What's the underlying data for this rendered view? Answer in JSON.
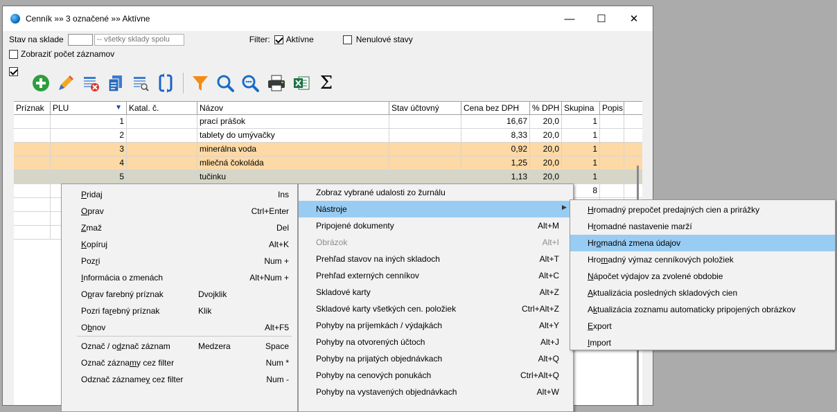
{
  "window": {
    "title": "Cenník »» 3 označené »» Aktívne",
    "minimize": "—",
    "maximize": "☐",
    "close": "✕"
  },
  "filters": {
    "stock_label": "Stav na sklade",
    "stock_combo": "-- všetky sklady spolu",
    "filter_label": "Filter:",
    "active_label": "Aktívne",
    "active_checked": true,
    "nonzero_label": "Nenulové stavy",
    "nonzero_checked": false,
    "show_count_label": "Zobraziť počet záznamov",
    "show_count_checked": false
  },
  "toolbar": [
    "add-icon",
    "edit-icon",
    "delete-icon",
    "copy-icon",
    "preview-icon",
    "refresh-icon",
    "filter-icon",
    "search-icon",
    "search-more-icon",
    "print-icon",
    "excel-icon",
    "sum-icon"
  ],
  "colors": {
    "orange_row": "#fdd9a5",
    "highlight": "#99ccf2",
    "selected_row": "#d6d6c8"
  },
  "grid": {
    "columns": [
      "Príznak",
      "PLU",
      "Katal. č.",
      "Názov",
      "Stav účtovný",
      "Cena bez DPH",
      "% DPH",
      "Skupina",
      "Popis"
    ],
    "rows": [
      {
        "flag": "",
        "plu": "1",
        "cat": "",
        "name": "prací prášok",
        "stock": "",
        "price": "16,67",
        "vat": "20,0",
        "group": "1",
        "desc": "",
        "style": ""
      },
      {
        "flag": "",
        "plu": "2",
        "cat": "",
        "name": "tablety do umývačky",
        "stock": "",
        "price": "8,33",
        "vat": "20,0",
        "group": "1",
        "desc": "",
        "style": ""
      },
      {
        "flag": "",
        "plu": "3",
        "cat": "",
        "name": "minerálna voda",
        "stock": "",
        "price": "0,92",
        "vat": "20,0",
        "group": "1",
        "desc": "",
        "style": "orange"
      },
      {
        "flag": "",
        "plu": "4",
        "cat": "",
        "name": "mliečná čokoláda",
        "stock": "",
        "price": "1,25",
        "vat": "20,0",
        "group": "1",
        "desc": "",
        "style": "orange"
      },
      {
        "flag": "",
        "plu": "5",
        "cat": "",
        "name": "tučinku",
        "stock": "",
        "price": "1,13",
        "vat": "20,0",
        "group": "1",
        "desc": "",
        "style": "grey"
      },
      {
        "flag": "",
        "plu": "",
        "cat": "",
        "name": "",
        "stock": "",
        "price": "",
        "vat": "",
        "group": "8",
        "desc": "",
        "style": ""
      },
      {
        "flag": "",
        "plu": "",
        "cat": "",
        "name": "",
        "stock": "",
        "price": "",
        "vat": "",
        "group": "",
        "desc": "",
        "style": ""
      },
      {
        "flag": "",
        "plu": "",
        "cat": "",
        "name": "",
        "stock": "",
        "price": "",
        "vat": "",
        "group": "",
        "desc": "",
        "style": ""
      },
      {
        "flag": "",
        "plu": "",
        "cat": "",
        "name": "",
        "stock": "",
        "price": "",
        "vat": "",
        "group": "",
        "desc": "",
        "style": ""
      }
    ]
  },
  "context_menu": [
    {
      "pre": "",
      "u": "P",
      "post": "ridaj",
      "mid": "",
      "sc": "Ins"
    },
    {
      "pre": "",
      "u": "O",
      "post": "prav",
      "mid": "",
      "sc": "Ctrl+Enter"
    },
    {
      "pre": "",
      "u": "Z",
      "post": "maž",
      "mid": "",
      "sc": "Del"
    },
    {
      "pre": "",
      "u": "K",
      "post": "opíruj",
      "mid": "",
      "sc": "Alt+K"
    },
    {
      "pre": "Poz",
      "u": "r",
      "post": "i",
      "mid": "",
      "sc": "Num +"
    },
    {
      "pre": "",
      "u": "I",
      "post": "nformácia o zmenách",
      "mid": "",
      "sc": "Alt+Num +"
    },
    {
      "pre": "O",
      "u": "p",
      "post": "rav farebný príznak",
      "mid": "Dvojklik",
      "sc": ""
    },
    {
      "pre": "Pozri fa",
      "u": "r",
      "post": "ebný príznak",
      "mid": "Klik",
      "sc": ""
    },
    {
      "pre": "O",
      "u": "b",
      "post": "nov",
      "mid": "",
      "sc": "Alt+F5"
    },
    {
      "pre": "Označ / o",
      "u": "d",
      "post": "znač záznam",
      "mid": "Medzera",
      "sc": "Space"
    },
    {
      "pre": "Označ zázna",
      "u": "m",
      "post": "y cez filter",
      "mid": "",
      "sc": "Num *"
    },
    {
      "pre": "Odznač zázname",
      "u": "y",
      "post": " cez filter",
      "mid": "",
      "sc": "Num -"
    }
  ],
  "tools_menu": [
    {
      "label": "Zobraz vybrané udalosti zo žurnálu",
      "sc": "",
      "state": ""
    },
    {
      "label": "Nástroje",
      "sc": "",
      "state": "hl"
    },
    {
      "label": "Pripojené dokumenty",
      "sc": "Alt+M",
      "state": ""
    },
    {
      "label": "Obrázok",
      "sc": "Alt+I",
      "state": "dis"
    },
    {
      "label": "Prehľad stavov na iných skladoch",
      "sc": "Alt+T",
      "state": ""
    },
    {
      "label": "Prehľad externých cenníkov",
      "sc": "Alt+C",
      "state": ""
    },
    {
      "label": "Skladové karty",
      "sc": "Alt+Z",
      "state": ""
    },
    {
      "label": "Skladové karty všetkých cen. položiek",
      "sc": "Ctrl+Alt+Z",
      "state": ""
    },
    {
      "label": "Pohyby na príjemkách / výdajkách",
      "sc": "Alt+Y",
      "state": ""
    },
    {
      "label": "Pohyby na otvorených účtoch",
      "sc": "Alt+J",
      "state": ""
    },
    {
      "label": "Pohyby na prijatých objednávkach",
      "sc": "Alt+Q",
      "state": ""
    },
    {
      "label": "Pohyby na cenových ponukách",
      "sc": "Ctrl+Alt+Q",
      "state": ""
    },
    {
      "label": "Pohyby na vystavených objednávkach",
      "sc": "Alt+W",
      "state": ""
    }
  ],
  "submenu": [
    {
      "pre": "",
      "u": "H",
      "post": "romadný prepočet predajných cien a prirážky",
      "state": ""
    },
    {
      "pre": "H",
      "u": "r",
      "post": "omadné nastavenie marží",
      "state": ""
    },
    {
      "pre": "Hr",
      "u": "o",
      "post": "madná zmena údajov",
      "state": "hl"
    },
    {
      "pre": "Hro",
      "u": "m",
      "post": "adný výmaz cenníkových položiek",
      "state": ""
    },
    {
      "pre": "",
      "u": "N",
      "post": "ápočet výdajov za zvolené obdobie",
      "state": ""
    },
    {
      "pre": "",
      "u": "A",
      "post": "ktualizácia posledných skladových cien",
      "state": ""
    },
    {
      "pre": "A",
      "u": "k",
      "post": "tualizácia zoznamu automaticky pripojených obrázkov",
      "state": ""
    },
    {
      "pre": "",
      "u": "E",
      "post": "xport",
      "state": ""
    },
    {
      "pre": "",
      "u": "I",
      "post": "mport",
      "state": ""
    }
  ]
}
